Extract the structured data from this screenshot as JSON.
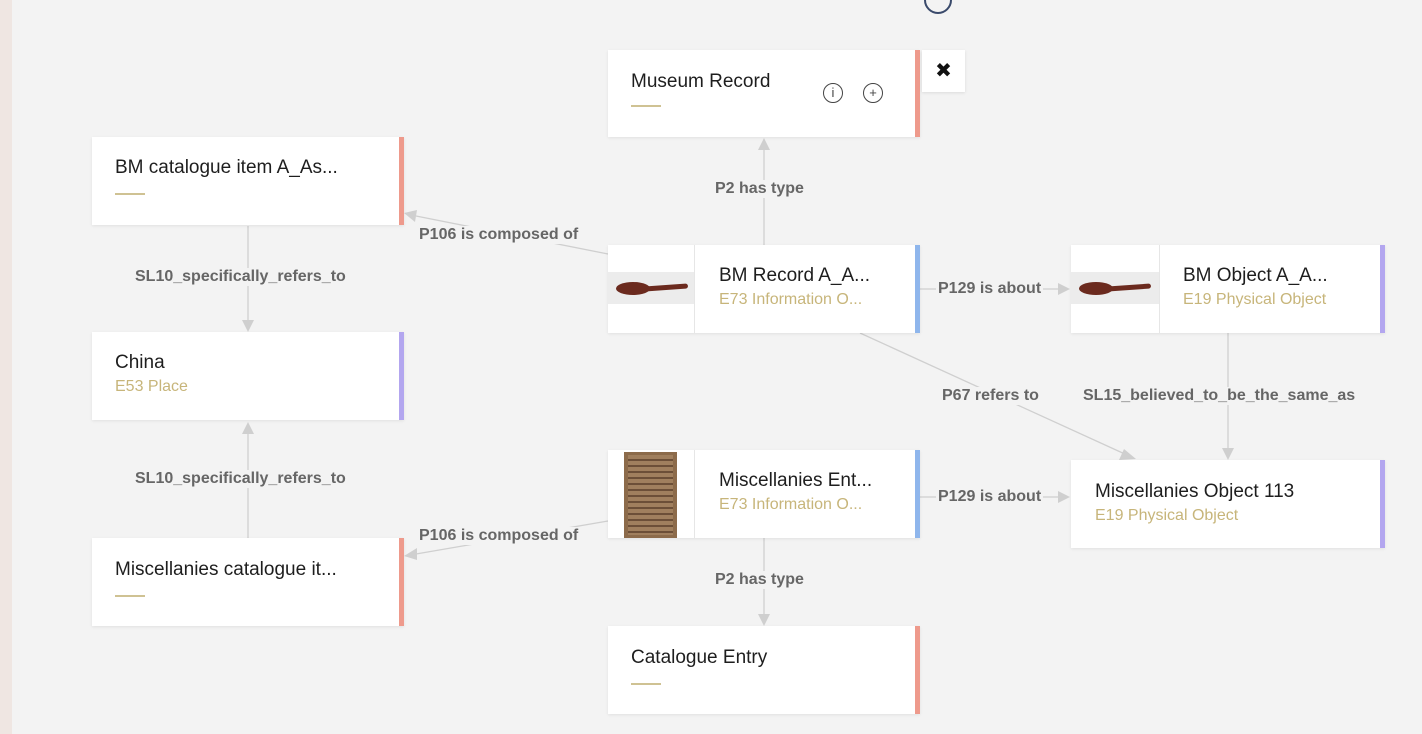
{
  "nodes": {
    "museum_record": {
      "title": "Museum Record",
      "sub": ""
    },
    "bm_catalogue_item": {
      "title": "BM catalogue item A_As...",
      "sub": ""
    },
    "china": {
      "title": "China",
      "sub": "E53 Place"
    },
    "misc_catalogue_item": {
      "title": "Miscellanies catalogue it...",
      "sub": ""
    },
    "bm_record": {
      "title": "BM Record A_A...",
      "sub": "E73 Information O..."
    },
    "bm_object": {
      "title": "BM Object A_A...",
      "sub": "E19 Physical Object"
    },
    "misc_entry": {
      "title": "Miscellanies Ent...",
      "sub": "E73 Information O..."
    },
    "misc_object": {
      "title": "Miscellanies Object 113",
      "sub": "E19 Physical Object"
    },
    "catalogue_entry": {
      "title": "Catalogue Entry",
      "sub": ""
    }
  },
  "edges": {
    "p2_top": "P2 has type",
    "p106_top": "P106 is composed of",
    "sl10_top": "SL10_specifically_refers_to",
    "p129_top": "P129 is about",
    "p67": "P67 refers to",
    "sl15": "SL15_believed_to_be_the_same_as",
    "sl10_bottom": "SL10_specifically_refers_to",
    "p129_bottom": "P129 is about",
    "p106_bottom": "P106 is composed of",
    "p2_bottom": "P2 has type"
  },
  "controls": {
    "close": "✖",
    "info_icon": "info-icon",
    "add_icon": "plus-circle-icon"
  },
  "colors": {
    "type_accent_salmon": "#ee9a8c",
    "type_accent_lavender": "#b3a6ef",
    "type_accent_blue": "#8fb6ec",
    "subtitle": "#c7b57a"
  }
}
